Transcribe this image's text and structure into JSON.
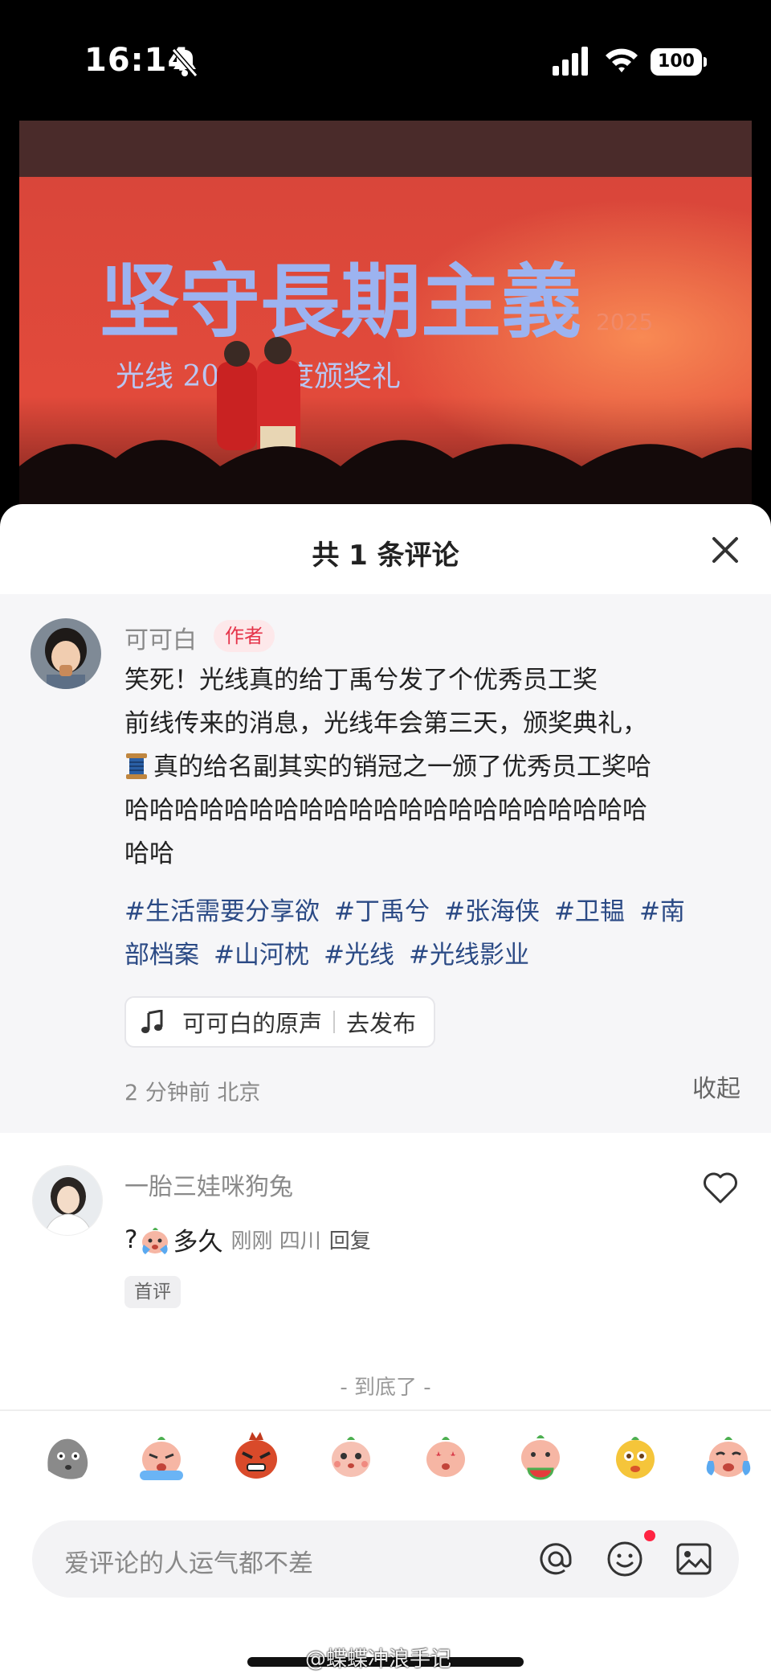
{
  "status_bar": {
    "time": "16:14",
    "battery": "100"
  },
  "video": {
    "banner_text": "坚守長期主義",
    "banner_sub": "光线 2024年度颁奖礼",
    "side_text": "2025"
  },
  "panel": {
    "title": "共 1 条评论"
  },
  "author_comment": {
    "username": "可可白",
    "badge": "作者",
    "line1": "笑死！光线真的给丁禹兮发了个优秀员工奖",
    "line2": "前线传来的消息，光线年会第三天，颁奖典礼，",
    "line3": "真的给名副其实的销冠之一颁了优秀员工奖哈",
    "line4": "哈哈哈哈哈哈哈哈哈哈哈哈哈哈哈哈哈哈哈哈哈",
    "line5": "哈哈",
    "tags": [
      "#生活需要分享欲",
      "#丁禹兮",
      "#张海侠",
      "#卫韫",
      "#南",
      "部档案",
      "#山河枕",
      "#光线",
      "#光线影业"
    ],
    "sound_label": "可可白的原声",
    "sound_action": "去发布",
    "meta": "2 分钟前  北京",
    "collapse": "收起"
  },
  "reply": {
    "username": "一胎三娃咪狗兔",
    "prefix": "?",
    "text": "多久",
    "meta": "刚刚  四川",
    "reply_label": "回复",
    "badge": "首评"
  },
  "end_text": "- 到底了 -",
  "emoji_bar": [
    "stone-face",
    "crying-peach",
    "angry-red",
    "shy-peach",
    "starry-peach",
    "watermelon-peach",
    "yellow-star-face",
    "tears-peach"
  ],
  "input": {
    "placeholder": "爱评论的人运气都不差"
  },
  "watermark": "@蝶蝶冲浪手记",
  "colors": {
    "accent": "#ff2442",
    "tag": "#2b4a85",
    "badge_bg": "#fde8ea",
    "badge_text": "#e5344a"
  }
}
